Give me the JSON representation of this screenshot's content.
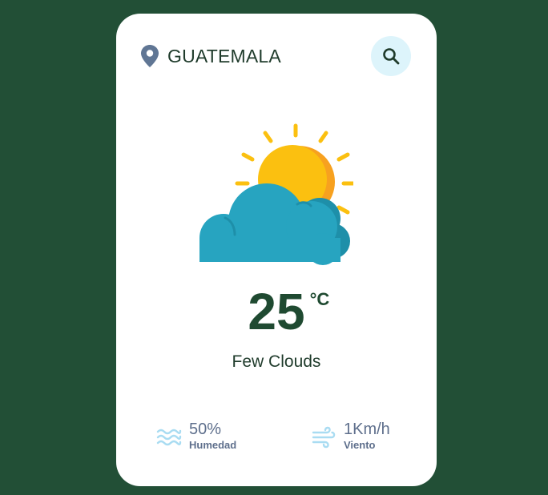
{
  "location": {
    "city": "GUATEMALA",
    "icon": "map-pin-icon"
  },
  "search": {
    "icon": "search-icon"
  },
  "weather": {
    "icon": "sun-cloud-icon",
    "temperature": "25",
    "unit": "°C",
    "description": "Few Clouds"
  },
  "stats": {
    "humidity": {
      "value": "50%",
      "label": "Humedad",
      "icon": "humidity-waves-icon"
    },
    "wind": {
      "value": "1Km/h",
      "label": "Viento",
      "icon": "wind-icon"
    }
  },
  "colors": {
    "background": "#224f36",
    "card": "#ffffff",
    "accent_text": "#1f4a31",
    "muted_text": "#5e6f8c",
    "search_bg": "#ddf4fb",
    "sun": "#fbc010",
    "cloud": "#27a4c0"
  }
}
